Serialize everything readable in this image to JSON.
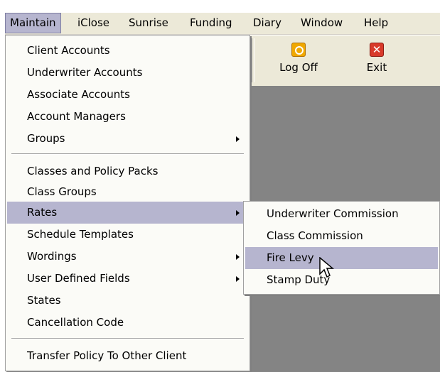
{
  "menubar": {
    "items": [
      "Maintain",
      "iClose",
      "Sunrise",
      "Funding",
      "Diary",
      "Window",
      "Help"
    ]
  },
  "toolbar": {
    "logoff": {
      "label": "Log Off",
      "icon": "key-icon"
    },
    "exit": {
      "label": "Exit",
      "icon": "close-icon"
    }
  },
  "main_menu": {
    "group1": [
      "Client Accounts",
      "Underwriter Accounts",
      "Associate Accounts",
      "Account Managers",
      "Groups"
    ],
    "group2": [
      "Classes and Policy Packs",
      "Class Groups",
      "Rates",
      "Schedule Templates",
      "Wordings",
      "User Defined Fields",
      "States",
      "Cancellation Code"
    ],
    "group3": [
      "Transfer Policy To Other Client"
    ]
  },
  "sub_menu": {
    "items": [
      "Underwriter Commission",
      "Class Commission",
      "Fire Levy",
      "Stamp Duty"
    ]
  },
  "colors": {
    "highlight": "#b6b5cf",
    "menubar": "#ece9d8",
    "workspace": "#848484"
  }
}
